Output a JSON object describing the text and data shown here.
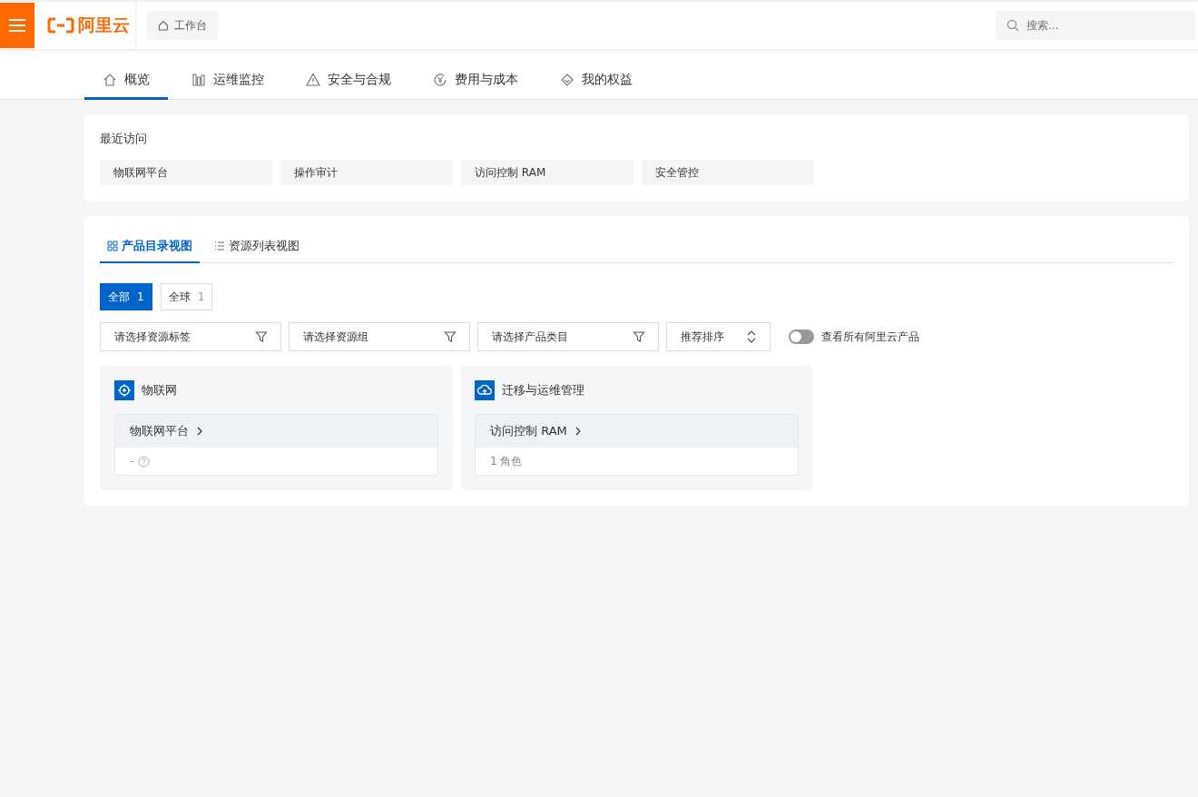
{
  "header": {
    "logo": "阿里云",
    "workbench": "工作台",
    "search": {
      "placeholder": "搜索..."
    }
  },
  "nav_tabs": [
    {
      "label": "概览",
      "selected": true
    },
    {
      "label": "运维监控",
      "selected": false
    },
    {
      "label": "安全与合规",
      "selected": false
    },
    {
      "label": "费用与成本",
      "selected": false
    },
    {
      "label": "我的权益",
      "selected": false
    }
  ],
  "recent": {
    "title": "最近访问",
    "items": [
      "物联网平台",
      "操作审计",
      "访问控制 RAM",
      "安全管控"
    ]
  },
  "view_tabs": [
    {
      "label": "产品目录视图",
      "selected": true
    },
    {
      "label": "资源列表视图",
      "selected": false
    }
  ],
  "scopes": [
    {
      "label": "全部",
      "count": "1",
      "selected": true
    },
    {
      "label": "全球",
      "count": "1",
      "selected": false
    }
  ],
  "filters": [
    "请选择资源标签",
    "请选择资源组",
    "请选择产品类目"
  ],
  "sort": "推荐排序",
  "show_all": {
    "label": "查看所有阿里云产品",
    "on": false
  },
  "categories": [
    {
      "title": "物联网",
      "products": [
        {
          "name": "物联网平台",
          "value": "-",
          "help": true
        }
      ]
    },
    {
      "title": "迁移与运维管理",
      "products": [
        {
          "name": "访问控制 RAM",
          "value": "1 角色",
          "help": false
        }
      ]
    }
  ]
}
